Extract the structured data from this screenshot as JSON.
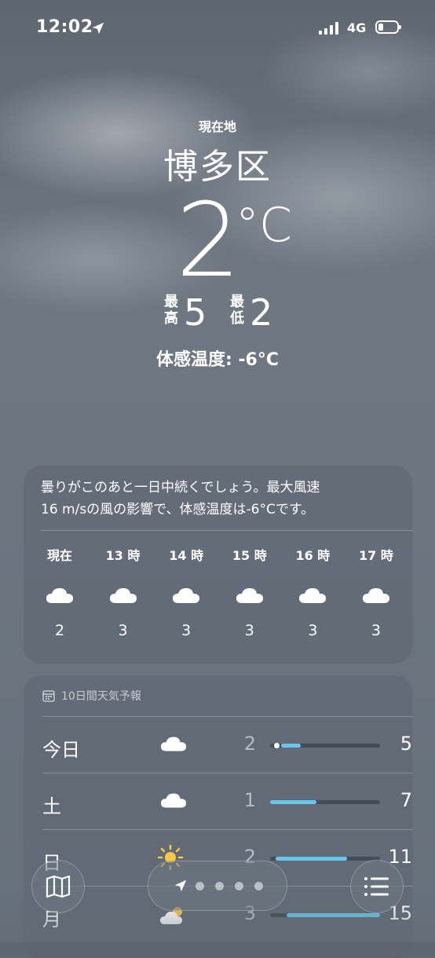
{
  "status": {
    "time": "12:02",
    "network": "4G"
  },
  "hero": {
    "location_label": "現在地",
    "city": "博多区",
    "temp": "2",
    "unit": "°C",
    "high_label_top": "最",
    "high_label_bottom": "高",
    "high": "5",
    "low_label_top": "最",
    "low_label_bottom": "低",
    "low": "2",
    "feels_like": "体感温度: -6°C"
  },
  "hourly": {
    "summary_line1": "曇りがこのあと一日中続くでしょう。最大風速",
    "summary_line2": "16 m/sの風の影響で、体感温度は-6°Cです。",
    "items": [
      {
        "label": "現在",
        "icon": "cloud-icon",
        "temp": "2"
      },
      {
        "label": "13 時",
        "icon": "cloud-icon",
        "temp": "3"
      },
      {
        "label": "14 時",
        "icon": "cloud-icon",
        "temp": "3"
      },
      {
        "label": "15 時",
        "icon": "cloud-icon",
        "temp": "3"
      },
      {
        "label": "16 時",
        "icon": "cloud-icon",
        "temp": "3"
      },
      {
        "label": "17 時",
        "icon": "cloud-icon",
        "temp": "3"
      }
    ]
  },
  "forecast": {
    "title": "10日間天気予報",
    "days": [
      {
        "day": "今日",
        "icon": "cloud-icon",
        "low": "2",
        "high": "5",
        "range_start": 0.1,
        "range_end": 0.28,
        "current": 0.06
      },
      {
        "day": "土",
        "icon": "cloud-icon",
        "low": "1",
        "high": "7",
        "range_start": 0.0,
        "range_end": 0.42
      },
      {
        "day": "日",
        "icon": "sun-icon",
        "low": "2",
        "high": "11",
        "range_start": 0.05,
        "range_end": 0.7
      },
      {
        "day": "月",
        "icon": "partly-cloudy-icon",
        "low": "3",
        "high": "15",
        "range_start": 0.15,
        "range_end": 1.0
      }
    ]
  },
  "accent_color": "#6bc5ea"
}
